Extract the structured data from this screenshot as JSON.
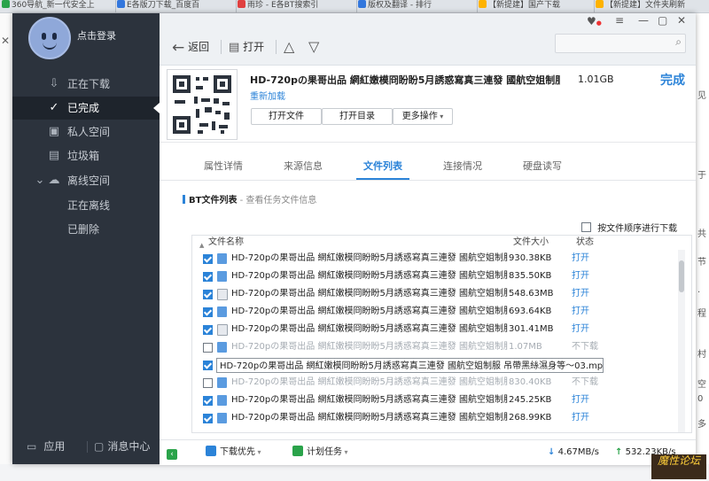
{
  "browser": {
    "tabs": [
      {
        "label": "360导航_新一代安全上",
        "color": "#2aa34a"
      },
      {
        "label": "E各版刀下载_百度百",
        "color": "#3377dd"
      },
      {
        "label": "雨珍 - E各BT搜索引",
        "color": "#e04040"
      },
      {
        "label": "版权及翻译 - 排行",
        "color": "#3377dd"
      },
      {
        "label": "【新提建】国产下载",
        "color": "#ffb300"
      },
      {
        "label": "【新提建】文件夹刷新",
        "color": "#ffb300"
      }
    ]
  },
  "sidebar": {
    "login": "点击登录",
    "items": [
      {
        "label": "正在下载",
        "icon": "download-icon"
      },
      {
        "label": "已完成",
        "icon": "check-circle-icon"
      },
      {
        "label": "私人空间",
        "icon": "lock-icon"
      },
      {
        "label": "垃圾箱",
        "icon": "trash-icon"
      },
      {
        "label": "离线空间",
        "icon": "cloud-icon"
      },
      {
        "label": "正在离线"
      },
      {
        "label": "已删除"
      }
    ],
    "bottom": {
      "apps": "应用",
      "messages": "消息中心"
    }
  },
  "toolbar": {
    "back": "返回",
    "open": "打开"
  },
  "task": {
    "title": "HD-720pの果哥出品 網紅嫩模冏盼盼5月誘惑寫真三連發 國航空姐制服 吊帶...",
    "readd": "重新加载",
    "size": "1.01GB",
    "status": "完成",
    "buttons": {
      "open_file": "打开文件",
      "open_dir": "打开目录",
      "more": "更多操作"
    }
  },
  "tabs": [
    "属性详情",
    "来源信息",
    "文件列表",
    "连接情况",
    "硬盘读写"
  ],
  "filelist": {
    "title": "BT文件列表",
    "subtitle": " - 查看任务文件信息",
    "seq_label": "按文件顺序进行下载",
    "headers": {
      "name": "文件名称",
      "size": "文件大小",
      "status": "状态"
    },
    "rows": [
      {
        "name": "HD-720pの果哥出品 網紅嫩模冏盼盼5月誘惑寫真三連發 國航空姐制服...",
        "size": "930.38KB",
        "status": "打开",
        "checked": true,
        "media": false
      },
      {
        "name": "HD-720pの果哥出品 網紅嫩模冏盼盼5月誘惑寫真三連發 國航空姐制服...",
        "size": "835.50KB",
        "status": "打开",
        "checked": true,
        "media": false
      },
      {
        "name": "HD-720pの果哥出品 網紅嫩模冏盼盼5月誘惑寫真三連發 國航空姐制服...",
        "size": "548.63MB",
        "status": "打开",
        "checked": true,
        "media": true
      },
      {
        "name": "HD-720pの果哥出品 網紅嫩模冏盼盼5月誘惑寫真三連發 國航空姐制服...",
        "size": "693.64KB",
        "status": "打开",
        "checked": true,
        "media": false
      },
      {
        "name": "HD-720pの果哥出品 網紅嫩模冏盼盼5月誘惑寫真三連發 國航空姐制服...",
        "size": "301.41MB",
        "status": "打开",
        "checked": true,
        "media": true
      },
      {
        "name": "HD-720pの果哥出品 網紅嫩模冏盼盼5月誘惑寫真三連發 國航空姐制服...",
        "size": "1.07MB",
        "status": "不下载",
        "checked": false,
        "media": false
      },
      {
        "name": "HD-720pの果哥出品 網紅嫩模冏盼盼5月誘惑寫真三連發 國航空姐制服...",
        "size": "",
        "status": "",
        "checked": true,
        "media": true
      },
      {
        "name": "HD-720pの果哥出品 網紅嫩模冏盼盼5月誘惑寫真三連發 國航空姐制服...",
        "size": "830.40KB",
        "status": "不下载",
        "checked": false,
        "media": false
      },
      {
        "name": "HD-720pの果哥出品 網紅嫩模冏盼盼5月誘惑寫真三連發 國航空姐制服...",
        "size": "245.25KB",
        "status": "打开",
        "checked": true,
        "media": false
      },
      {
        "name": "HD-720pの果哥出品 網紅嫩模冏盼盼5月誘惑寫真三連發 國航空姐制服...",
        "size": "268.99KB",
        "status": "打开",
        "checked": true,
        "media": false
      }
    ],
    "tooltip": "HD-720pの果哥出品 網紅嫩模冏盼盼5月誘惑寫真三連發 國航空姐制服 吊帶黑絲濕身等～03.mp4"
  },
  "statusbar": {
    "priority": "下载优先",
    "plan": "计划任务",
    "down_speed": "4.67MB/s",
    "up_speed": "532.23KB/s"
  },
  "watermark": "魔性论坛",
  "colors": {
    "accent": "#2b83d8",
    "sidebar": "#2c333d",
    "green": "#2aa34a"
  }
}
